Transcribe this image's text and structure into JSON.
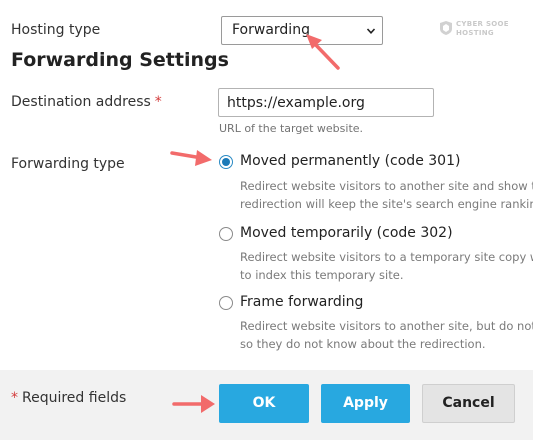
{
  "hosting_type": {
    "label": "Hosting type",
    "selected": "Forwarding"
  },
  "watermark": {
    "line1": "CYBER SOOE",
    "line2": "HOSTING"
  },
  "section_title": "Forwarding Settings",
  "destination": {
    "label": "Destination address",
    "required_mark": "*",
    "value": "https://example.org",
    "hint": "URL of the target website."
  },
  "forwarding_type": {
    "label": "Forwarding type",
    "options": [
      {
        "label": "Moved permanently (code 301)",
        "checked": true,
        "desc_line1": "Redirect website visitors to another site and show th",
        "desc_line2": "redirection will keep the site's search engine rankings"
      },
      {
        "label": "Moved temporarily (code 302)",
        "checked": false,
        "desc_line1": "Redirect website visitors to a temporary site copy wh",
        "desc_line2": "to index this temporary site."
      },
      {
        "label": "Frame forwarding",
        "checked": false,
        "desc_line1": "Redirect website visitors to another site, but do not s",
        "desc_line2": "so they do not know about the redirection."
      }
    ]
  },
  "footer": {
    "required_mark": "*",
    "required_text": "Required fields",
    "ok_label": "OK",
    "apply_label": "Apply",
    "cancel_label": "Cancel"
  },
  "colors": {
    "primary_button": "#28a8e0",
    "radio_checked": "#1b7ab8",
    "required_star": "#d33b3b",
    "annotation_arrow": "#f26b6b"
  },
  "icons": [
    "chevron-down-icon",
    "cyber-sooe-hosting-logo",
    "annotation-arrow-icon"
  ]
}
